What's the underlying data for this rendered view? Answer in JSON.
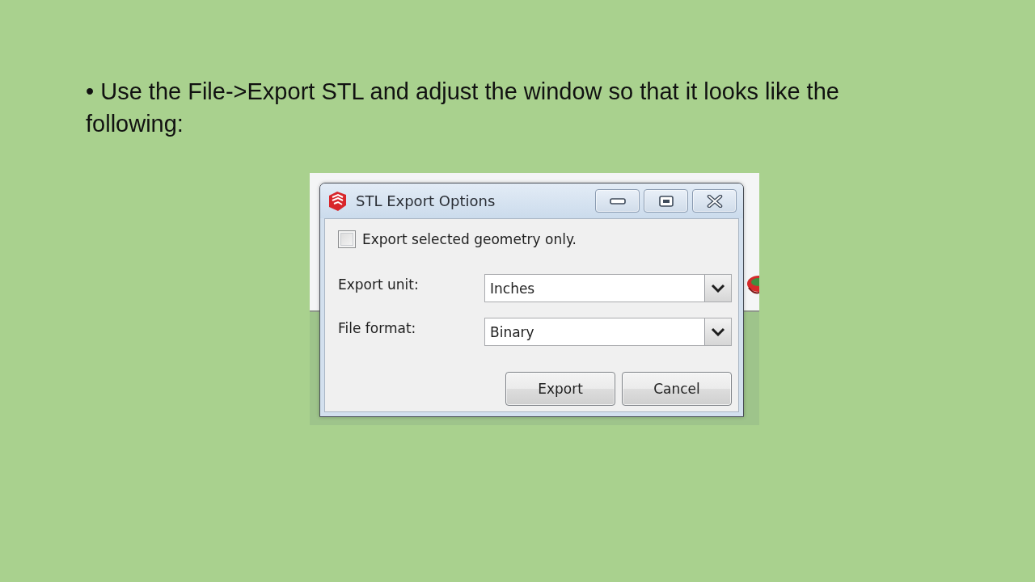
{
  "slide": {
    "bullet_text": "• Use the File->Export STL and adjust the window so that it looks like the following:"
  },
  "dialog": {
    "title": "STL Export Options",
    "checkbox": {
      "label": "Export selected geometry only.",
      "checked": false
    },
    "fields": [
      {
        "label": "Export unit:",
        "value": "Inches"
      },
      {
        "label": "File format:",
        "value": "Binary"
      }
    ],
    "buttons": [
      "Export",
      "Cancel"
    ]
  }
}
